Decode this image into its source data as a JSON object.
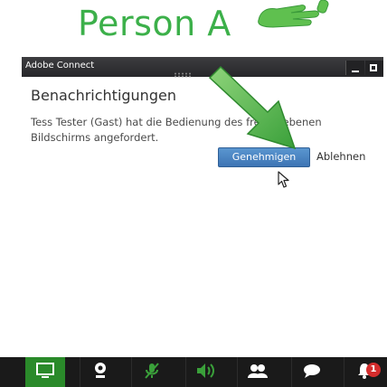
{
  "caption": {
    "label": "Person A"
  },
  "window": {
    "title": "Adobe Connect"
  },
  "notification": {
    "title": "Benachrichtigungen",
    "message_line1": "Tess Tester (Gast) hat die Bedienung des freigegebenen",
    "message_line2": "Bildschirms angefordert.",
    "approve_label": "Genehmigen",
    "decline_label": "Ablehnen"
  },
  "toolbar": {
    "items": [
      "share-screen",
      "camera",
      "microphone",
      "speaker",
      "attendees",
      "chat",
      "notifications"
    ],
    "notification_count": "1"
  },
  "colors": {
    "caption_text": "#3cb04a",
    "arrow_green": "#5fc04f",
    "approve_button": "#4a86c5",
    "toolbar_bg": "#1a1a1a",
    "toolbar_active": "#2a8a2a",
    "badge": "#d42d2d"
  },
  "icons": {
    "caption": "raised-hand-icon",
    "arrow": "green-arrow-icon",
    "cursor": "mouse-pointer-icon"
  }
}
